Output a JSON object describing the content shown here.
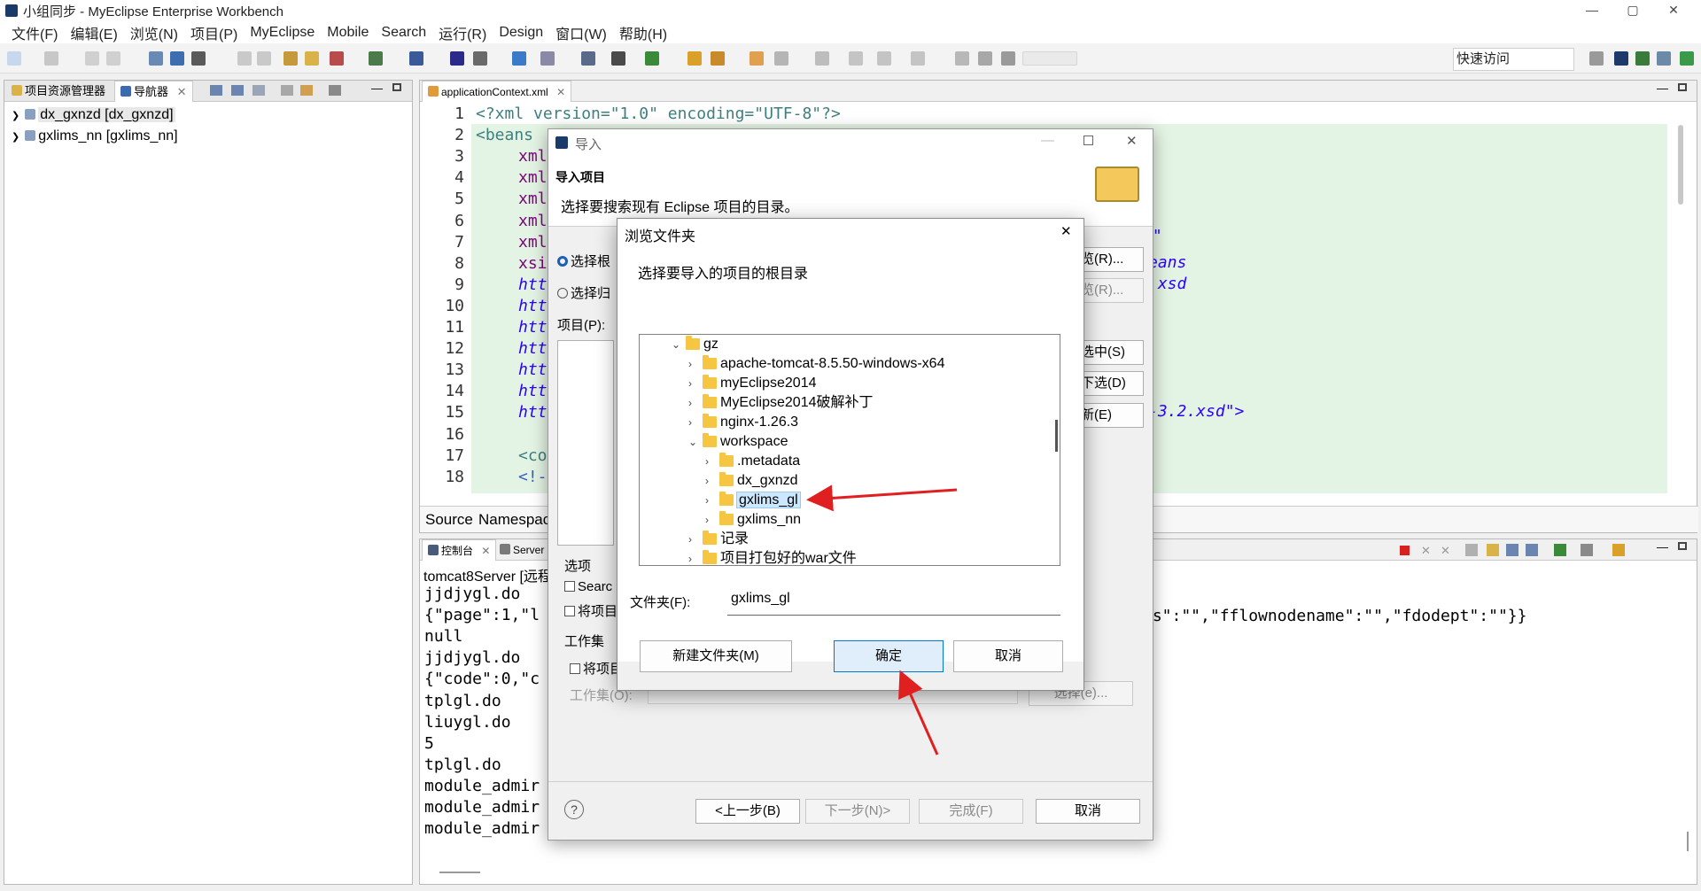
{
  "window": {
    "title": "小组同步 - MyEclipse Enterprise Workbench",
    "minimize": "—",
    "maximize": "▢",
    "close": "✕"
  },
  "menu": [
    "文件(F)",
    "编辑(E)",
    "浏览(N)",
    "项目(P)",
    "MyEclipse",
    "Mobile",
    "Search",
    "运行(R)",
    "Design",
    "窗口(W)",
    "帮助(H)"
  ],
  "quick_access": "快速访问",
  "left_panel": {
    "tabs": [
      "项目资源管理器",
      "导航器"
    ],
    "items": [
      "dx_gxnzd [dx_gxnzd]",
      "gxlims_nn [gxlims_nn]"
    ]
  },
  "editor": {
    "tab": "applicationContext.xml",
    "line_numbers": [
      "1",
      "2",
      "3",
      "4",
      "5",
      "6",
      "7",
      "8",
      "9",
      "10",
      "11",
      "12",
      "13",
      "14",
      "15",
      "16",
      "17",
      "18"
    ],
    "lines": [
      "<?xml version=\"1.0\" encoding=\"UTF-8\"?>",
      "<beans",
      "xml",
      "xml",
      "xml",
      "xml",
      "xml",
      "xsi",
      "htt",
      "htt",
      "htt",
      "htt",
      "htt",
      "htt",
      "htt",
      "",
      "<co",
      "<!-"
    ],
    "right_fragments": [
      ".\"",
      "eans",
      ".xsd",
      "-3.2.xsd\">"
    ],
    "bottom_tabs": [
      "Source",
      "Namespac"
    ]
  },
  "console": {
    "tabs": [
      "控制台",
      "Server"
    ],
    "header": "tomcat8Server [远程",
    "lines": [
      "jjdjygl.do",
      "{\"page\":1,\"l",
      "null",
      "jjdjygl.do",
      "{\"code\":0,\"c",
      "tplgl.do",
      "liuygl.do",
      "5",
      "tplgl.do",
      "module_admir",
      "module_admir",
      "module_admir"
    ],
    "right_text": "us\":\"\",\"fflownodename\":\"\",\"fdodept\":\"\"}}"
  },
  "import_dialog": {
    "title": "导入",
    "heading": "导入项目",
    "description": "选择要搜索现有 Eclipse 项目的目录。",
    "radio_root": "选择根",
    "radio_archive": "选择归",
    "projects_label": "项目(P):",
    "browse_root": "览(R)...",
    "browse_archive": "览(R)...",
    "select_all": "选中(S)",
    "deselect_all": "下选(D)",
    "refresh": "新(E)",
    "options_label": "选项",
    "opt_search": "Searc",
    "opt_copy": "将项目",
    "workset_label": "工作集",
    "workset_check": "将项目",
    "workset_field": "工作集(O):",
    "workset_select": "选择(e)...",
    "help": "?",
    "back": "<上一步(B)",
    "next": "下一步(N)>",
    "finish": "完成(F)",
    "cancel": "取消"
  },
  "browse_dialog": {
    "title": "浏览文件夹",
    "close": "✕",
    "prompt": "选择要导入的项目的根目录",
    "tree": [
      {
        "label": "gz",
        "expanded": true
      },
      {
        "label": "apache-tomcat-8.5.50-windows-x64"
      },
      {
        "label": "myEclipse2014"
      },
      {
        "label": "MyEclipse2014破解补丁"
      },
      {
        "label": "nginx-1.26.3"
      },
      {
        "label": "workspace",
        "expanded": true
      },
      {
        "label": ".metadata"
      },
      {
        "label": "dx_gxnzd"
      },
      {
        "label": "gxlims_gl",
        "selected": true
      },
      {
        "label": "gxlims_nn"
      },
      {
        "label": "记录"
      },
      {
        "label": "项目打包好的war文件"
      }
    ],
    "folder_label": "文件夹(F):",
    "folder_value": "gxlims_gl",
    "new_folder": "新建文件夹(M)",
    "ok": "确定",
    "cancel": "取消"
  },
  "colors": {
    "accent": "#0078d7",
    "annotation_arrow": "#e02020",
    "editor_highlight": "#e4f4e4"
  }
}
